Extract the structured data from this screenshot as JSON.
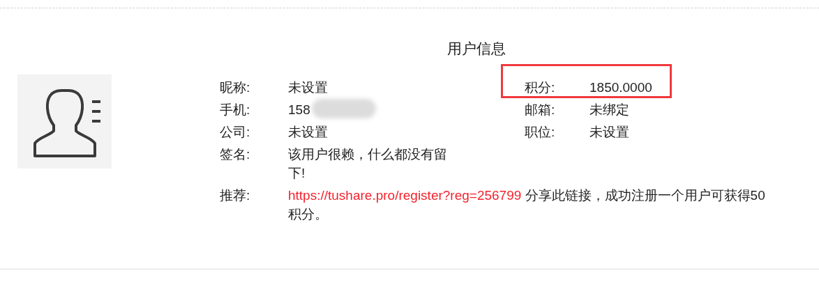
{
  "title": "用户信息",
  "left_fields": [
    {
      "label": "昵称:",
      "value": "未设置",
      "redacted": false
    },
    {
      "label": "手机:",
      "value": "158",
      "redacted": true
    },
    {
      "label": "公司:",
      "value": "未设置",
      "redacted": false
    },
    {
      "label": "签名:",
      "value": "该用户很赖，什么都没有留下!",
      "redacted": false
    }
  ],
  "right_fields": [
    {
      "label": "积分:",
      "value": "1850.0000",
      "highlighted": true
    },
    {
      "label": "邮箱:",
      "value": "未绑定",
      "highlighted": false
    },
    {
      "label": "职位:",
      "value": "未设置",
      "highlighted": false
    }
  ],
  "referral": {
    "label": "推荐:",
    "link": "https://tushare.pro/register?reg=256799",
    "text": "分享此链接，成功注册一个用户可获得50积分。"
  }
}
